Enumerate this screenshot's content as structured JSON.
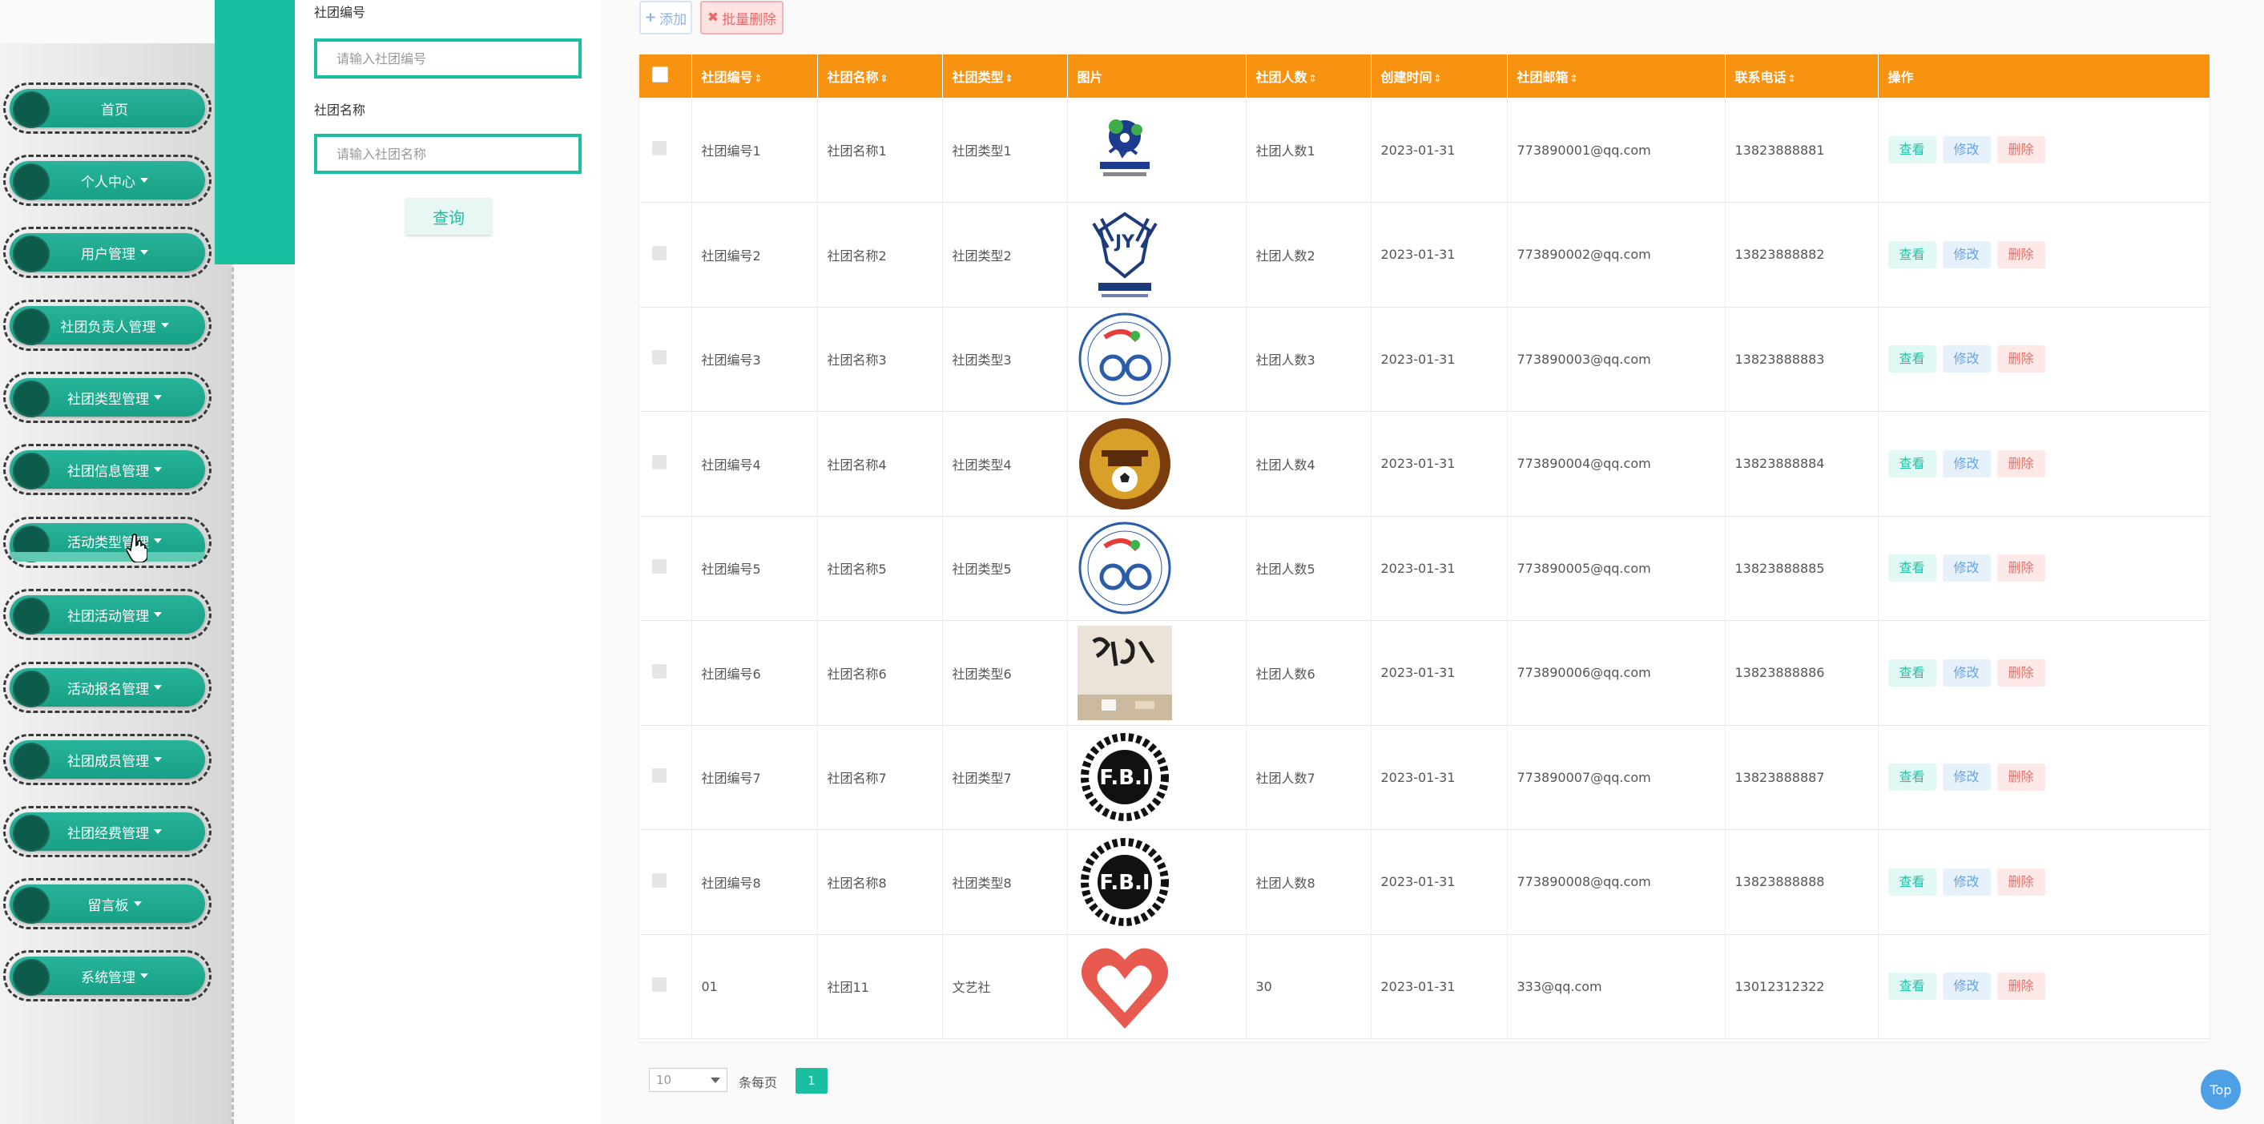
{
  "sidebar": {
    "items": [
      {
        "label": "首页",
        "has_caret": false
      },
      {
        "label": "个人中心",
        "has_caret": true
      },
      {
        "label": "用户管理",
        "has_caret": true
      },
      {
        "label": "社团负责人管理",
        "has_caret": true
      },
      {
        "label": "社团类型管理",
        "has_caret": true
      },
      {
        "label": "社团信息管理",
        "has_caret": true
      },
      {
        "label": "活动类型管理",
        "has_caret": true
      },
      {
        "label": "社团活动管理",
        "has_caret": true
      },
      {
        "label": "活动报名管理",
        "has_caret": true
      },
      {
        "label": "社团成员管理",
        "has_caret": true
      },
      {
        "label": "社团经费管理",
        "has_caret": true
      },
      {
        "label": "留言板",
        "has_caret": true
      },
      {
        "label": "系统管理",
        "has_caret": true
      }
    ],
    "hovered_item": "活动类型管理"
  },
  "search": {
    "club_no_label": "社团编号",
    "club_no_placeholder": "请输入社团编号",
    "club_name_label": "社团名称",
    "club_name_placeholder": "请输入社团名称",
    "query_label": "查询"
  },
  "toolbar": {
    "add_label": "添加",
    "batch_delete_label": "批量删除"
  },
  "table": {
    "headers": [
      "社团编号",
      "社团名称",
      "社团类型",
      "图片",
      "社团人数",
      "创建时间",
      "社团邮箱",
      "联系电话",
      "操作"
    ],
    "sortable": [
      true,
      true,
      true,
      false,
      true,
      true,
      true,
      true,
      false
    ],
    "sort_glyph": "⇕",
    "actions": {
      "view": "查看",
      "edit": "修改",
      "delete": "删除"
    },
    "rows": [
      {
        "no": "社团编号1",
        "name": "社团名称1",
        "type": "社团类型1",
        "logo": "basketball-club-logo",
        "members": "社团人数1",
        "created": "2023-01-31",
        "email": "773890001@qq.com",
        "phone": "13823888881"
      },
      {
        "no": "社团编号2",
        "name": "社团名称2",
        "type": "社团类型2",
        "logo": "eagle-jy-logo",
        "members": "社团人数2",
        "created": "2023-01-31",
        "email": "773890002@qq.com",
        "phone": "13823888882"
      },
      {
        "no": "社团编号3",
        "name": "社团名称3",
        "type": "社团类型3",
        "logo": "cycling-club-logo",
        "members": "社团人数3",
        "created": "2023-01-31",
        "email": "773890003@qq.com",
        "phone": "13823888883"
      },
      {
        "no": "社团编号4",
        "name": "社团名称4",
        "type": "社团类型4",
        "logo": "football-association-logo",
        "members": "社团人数4",
        "created": "2023-01-31",
        "email": "773890004@qq.com",
        "phone": "13823888884"
      },
      {
        "no": "社团编号5",
        "name": "社团名称5",
        "type": "社团类型5",
        "logo": "cycling-club-logo",
        "members": "社团人数5",
        "created": "2023-01-31",
        "email": "773890005@qq.com",
        "phone": "13823888885"
      },
      {
        "no": "社团编号6",
        "name": "社团名称6",
        "type": "社团类型6",
        "logo": "calligraphy-photo",
        "members": "社团人数6",
        "created": "2023-01-31",
        "email": "773890006@qq.com",
        "phone": "13823888886"
      },
      {
        "no": "社团编号7",
        "name": "社团名称7",
        "type": "社团类型7",
        "logo": "fbi-badge-logo",
        "members": "社团人数7",
        "created": "2023-01-31",
        "email": "773890007@qq.com",
        "phone": "13823888887"
      },
      {
        "no": "社团编号8",
        "name": "社团名称8",
        "type": "社团类型8",
        "logo": "fbi-badge-logo",
        "members": "社团人数8",
        "created": "2023-01-31",
        "email": "773890008@qq.com",
        "phone": "13823888888"
      },
      {
        "no": "01",
        "name": "社团11",
        "type": "文艺社",
        "logo": "heart-hands-logo",
        "members": "30",
        "created": "2023-01-31",
        "email": "333@qq.com",
        "phone": "13012312322"
      }
    ]
  },
  "pagination": {
    "page_size": "10",
    "per_page_label": "条每页",
    "current_page": "1"
  },
  "top_button": "Top",
  "colors": {
    "accent": "#19bfa0",
    "header_orange": "#f89211",
    "nav_green": "#1fa88f",
    "view": "#2bbfa4",
    "edit": "#66a3e0",
    "delete": "#e3716b"
  },
  "icons": {
    "add": "plus-icon",
    "batch_delete": "close-icon",
    "sort": "sort-icon",
    "dropdown": "chevron-down-icon"
  }
}
